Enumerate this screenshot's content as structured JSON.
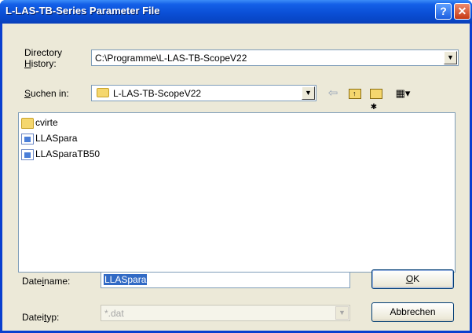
{
  "window": {
    "title": "L-LAS-TB-Series Parameter File"
  },
  "titlebar_buttons": {
    "help": "?",
    "close": "✕"
  },
  "directory_history": {
    "label_line1": "Directory",
    "label_line2_prefix": "",
    "label_line2_u": "H",
    "label_line2_rest": "istory:",
    "value": "C:\\Programme\\L-LAS-TB-ScopeV22"
  },
  "look_in": {
    "label_u": "S",
    "label_rest": "uchen in:",
    "value": "L-LAS-TB-ScopeV22"
  },
  "toolbar_icons": {
    "back": "⇦",
    "up": "🗁",
    "new_folder": "✱",
    "view": "▦▾"
  },
  "files": [
    {
      "name": "cvirte",
      "type": "folder"
    },
    {
      "name": "LLASpara",
      "type": "file"
    },
    {
      "name": "LLASparaTB50",
      "type": "file"
    }
  ],
  "filename": {
    "label_pre": "Date",
    "label_u": "i",
    "label_post": "name:",
    "value": "LLASpara"
  },
  "filetype": {
    "label_pre": "Datei",
    "label_u": "t",
    "label_post": "yp:",
    "value": "*.dat"
  },
  "buttons": {
    "ok_u": "O",
    "ok_rest": "K",
    "cancel": "Abbrechen"
  },
  "drop_arrow": "▼"
}
